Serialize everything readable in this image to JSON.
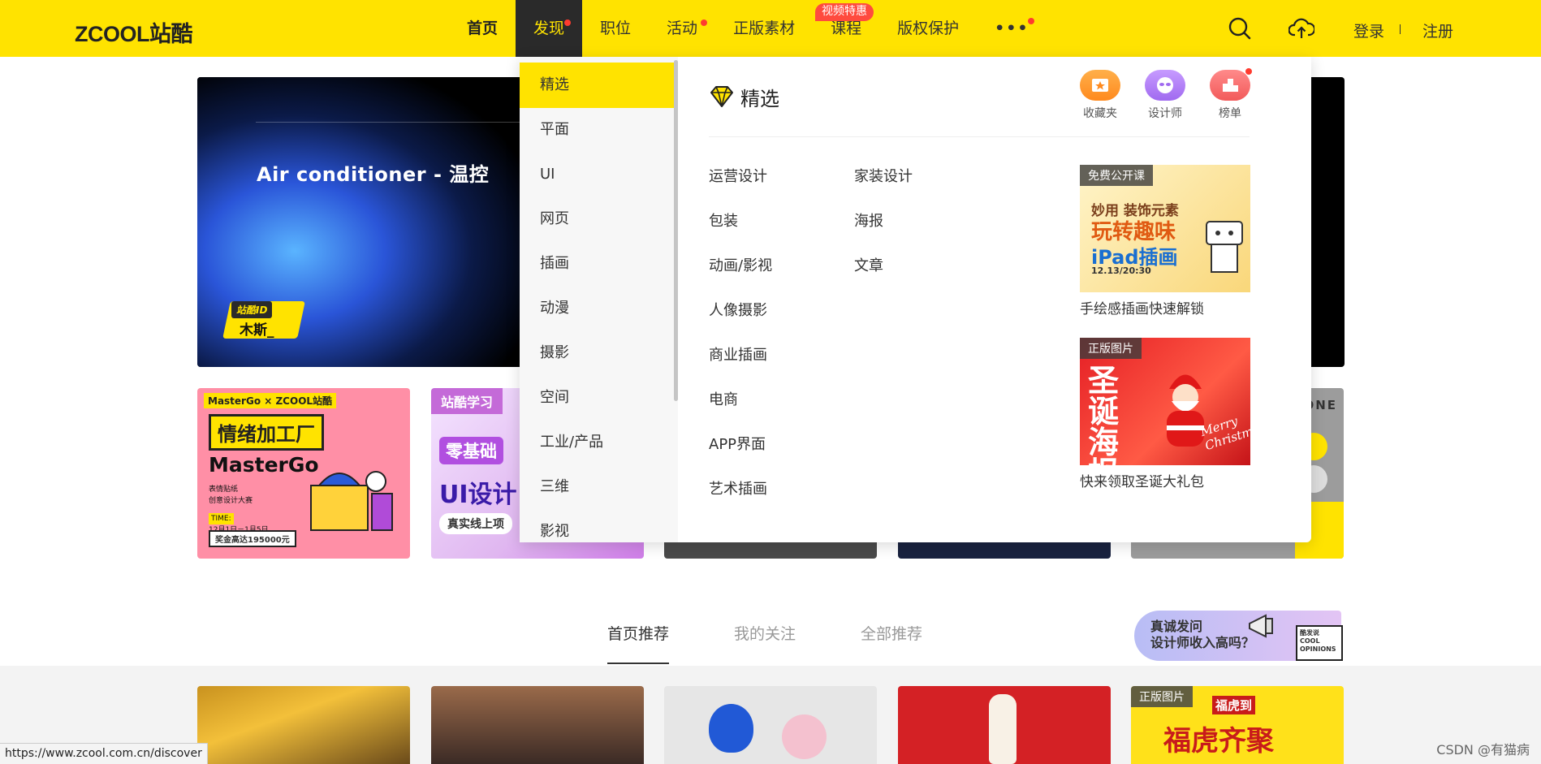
{
  "header": {
    "logo": "ZCOOL站酷",
    "nav": [
      {
        "label": "首页"
      },
      {
        "label": "发现"
      },
      {
        "label": "职位"
      },
      {
        "label": "活动"
      },
      {
        "label": "正版素材"
      },
      {
        "label": "课程"
      },
      {
        "label": "版权保护"
      },
      {
        "label": "•••"
      }
    ],
    "badge": "视频特惠",
    "login": "登录",
    "register": "注册",
    "accent": "#ffe300"
  },
  "banner": {
    "title": "Air conditioner - 温控",
    "id_label": "站酷ID",
    "id_name": "木斯_"
  },
  "cards": {
    "c1_tag": "MasterGo × ZCOOL站酷",
    "c1_head": "情绪加工厂",
    "c1_brand": "MasterGo",
    "c1_sub1": "表情贴纸",
    "c1_sub2": "创意设计大赛",
    "c1_time": "TIME:",
    "c1_date": "12月1日－1月5日",
    "c1_prize": "奖金高达195000元",
    "c2_tag": "站酷学习",
    "c2_head": "零基础",
    "c2_big": "UI设计",
    "c2_sub": "真实线上项",
    "c5_text": "ONE"
  },
  "dropdown": {
    "categories": [
      "精选",
      "平面",
      "UI",
      "网页",
      "插画",
      "动漫",
      "摄影",
      "空间",
      "工业/产品",
      "三维",
      "影视"
    ],
    "title": "精选",
    "quick": [
      {
        "label": "收藏夹",
        "color": "#ff9a2e"
      },
      {
        "label": "设计师",
        "color": "#b57cf5"
      },
      {
        "label": "榜单",
        "color": "#ff6b6b"
      }
    ],
    "sub_col1": [
      "运营设计",
      "包装",
      "动画/影视",
      "人像摄影",
      "商业插画",
      "电商",
      "APP界面",
      "艺术插画"
    ],
    "sub_col2": [
      "家装设计",
      "海报",
      "文章"
    ],
    "promo1": {
      "tag": "免费公开课",
      "line1": "妙用 装饰元素",
      "line2": "玩转趣味",
      "line3": "iPad插画",
      "line4": "12.13/20:30",
      "caption": "手绘感插画快速解锁"
    },
    "promo2": {
      "tag": "正版图片",
      "big": "圣诞海报",
      "merry": "Merry Christmas",
      "caption": "快来领取圣诞大礼包"
    }
  },
  "tabs": [
    "首页推荐",
    "我的关注",
    "全部推荐"
  ],
  "promo": {
    "line1": "真诚发问",
    "line2": "设计师收入高吗？",
    "box": "酷发说 COOL OPINIONS"
  },
  "feed": {
    "tag5": "正版图片",
    "f5_head": "福虎齐聚",
    "f5_sub": "福虎到"
  },
  "status_url": "https://www.zcool.com.cn/discover",
  "watermark": "CSDN @有猫病"
}
